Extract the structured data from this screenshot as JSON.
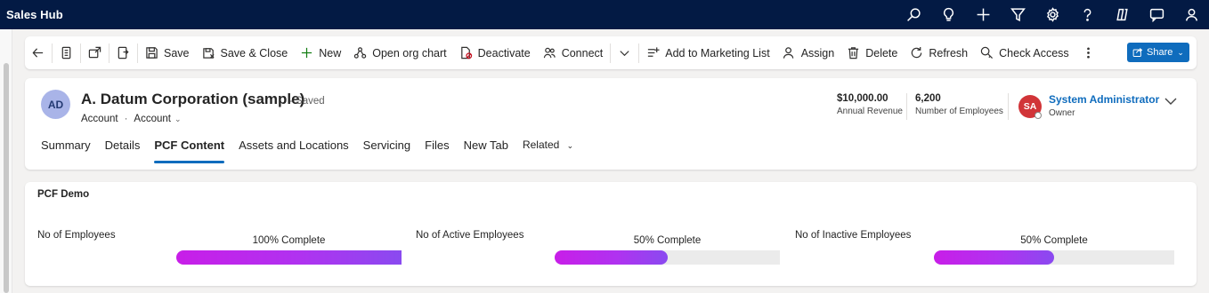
{
  "app": {
    "title": "Sales Hub"
  },
  "topbar": {
    "icons": [
      "search-icon",
      "lightbulb-icon",
      "plus-icon",
      "filter-icon",
      "settings-icon",
      "help-icon",
      "copilot-icon",
      "chat-icon",
      "feedback-icon"
    ]
  },
  "commands": {
    "save": "Save",
    "save_close": "Save & Close",
    "new": "New",
    "org_chart": "Open org chart",
    "deactivate": "Deactivate",
    "connect": "Connect",
    "add_marketing": "Add to Marketing List",
    "assign": "Assign",
    "delete": "Delete",
    "refresh": "Refresh",
    "check_access": "Check Access",
    "share": "Share"
  },
  "record": {
    "initials": "AD",
    "name": "A. Datum Corporation (sample)",
    "saved_status": "- Saved",
    "entity": "Account",
    "form": "Account",
    "annual_revenue_value": "$10,000.00",
    "annual_revenue_label": "Annual Revenue",
    "employees_value": "6,200",
    "employees_label": "Number of Employees",
    "owner_initials": "SA",
    "owner_name": "System Administrator",
    "owner_label": "Owner"
  },
  "tabs": {
    "summary": "Summary",
    "details": "Details",
    "pcf": "PCF Content",
    "assets": "Assets and Locations",
    "servicing": "Servicing",
    "files": "Files",
    "new_tab": "New Tab",
    "related": "Related"
  },
  "section": {
    "title": "PCF Demo",
    "fields": [
      {
        "label": "No of Employees",
        "progress_text": "100% Complete",
        "progress": 1.0
      },
      {
        "label": "No of Active Employees",
        "progress_text": "50% Complete",
        "progress": 0.5
      },
      {
        "label": "No of Inactive Employees",
        "progress_text": "50% Complete",
        "progress": 0.5
      }
    ]
  },
  "colors": {
    "topbar": "#031a44",
    "accent": "#0f6cbd",
    "progress_start": "#c81ee8",
    "progress_end": "#8a4af0",
    "owner_avatar": "#d13438",
    "record_avatar": "#a9b4e8"
  }
}
